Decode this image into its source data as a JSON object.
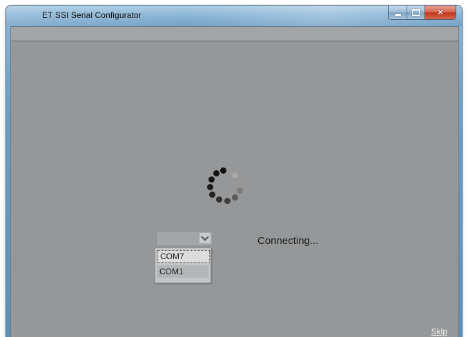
{
  "window": {
    "title": "ET SSI Serial Configurator"
  },
  "main": {
    "status_text": "Connecting...",
    "skip_label": "Skip"
  },
  "port_select": {
    "selected_value": "",
    "options": [
      "COM7",
      "COM1"
    ],
    "highlighted_option": "COM7"
  },
  "colors": {
    "client_bg": "#959799",
    "spinner_dark": "#151515",
    "spinner_light": "#8a8a8a"
  }
}
